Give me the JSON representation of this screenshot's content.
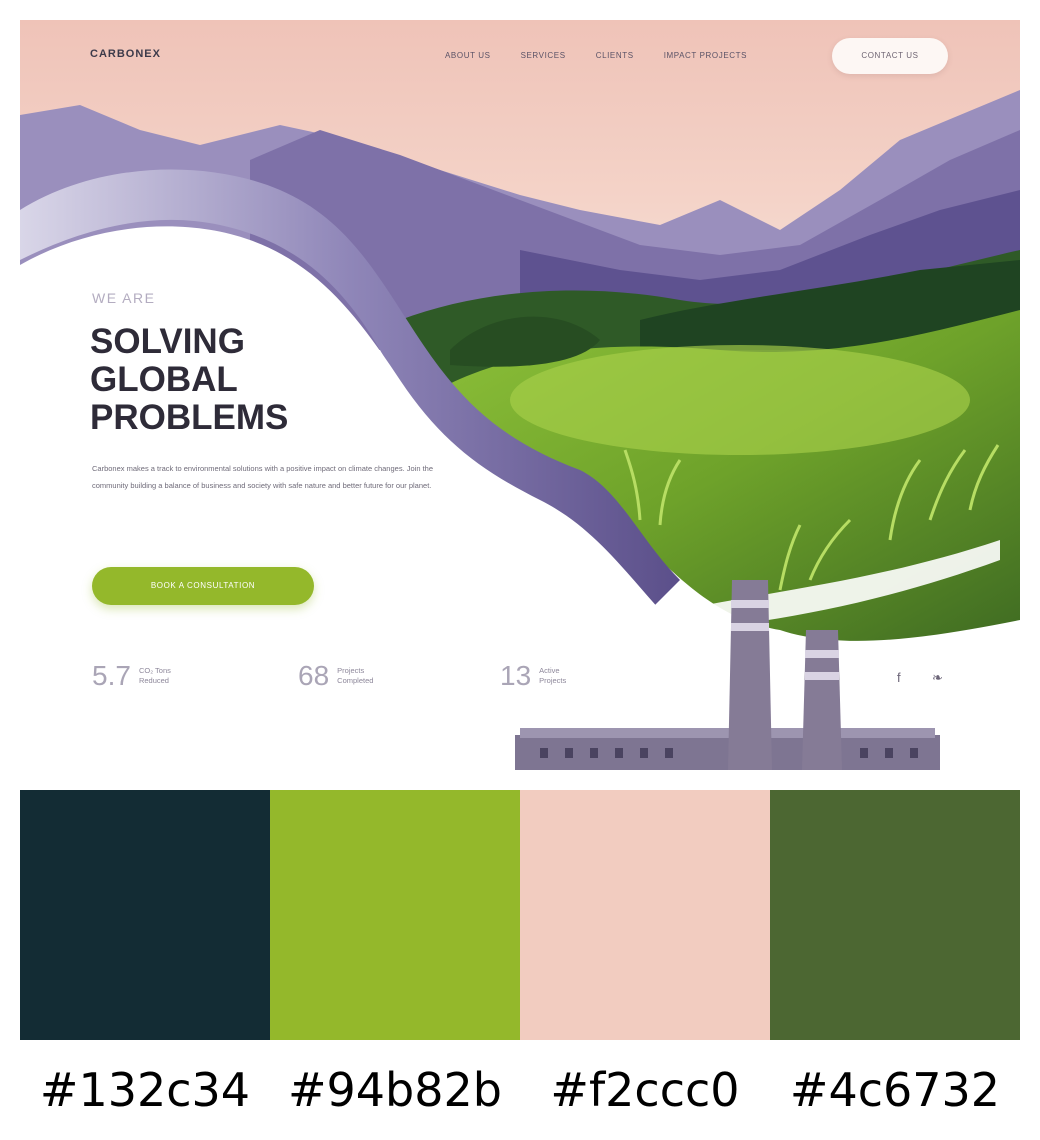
{
  "brand": {
    "logo": "CARBONEX"
  },
  "nav": {
    "links": [
      "ABOUT US",
      "SERVICES",
      "CLIENTS",
      "IMPACT PROJECTS"
    ],
    "contact_label": "CONTACT US"
  },
  "hero": {
    "eyebrow": "WE ARE",
    "headline": [
      "SOLVING",
      "GLOBAL",
      "PROBLEMS"
    ],
    "body": "Carbonex makes a track to environmental solutions with a positive impact on climate changes. Join the community building a balance of business and society with safe nature and better future for our planet.",
    "cta_label": "BOOK A CONSULTATION"
  },
  "stats": [
    {
      "value": "5.7",
      "label": [
        "CO₂ Tons",
        "Reduced"
      ]
    },
    {
      "value": "68",
      "label": [
        "Projects",
        "Completed"
      ]
    },
    {
      "value": "13",
      "label": [
        "Active",
        "Projects"
      ]
    }
  ],
  "social": {
    "facebook": "f",
    "twitter": "❧"
  },
  "palette": [
    {
      "hex": "#132c34",
      "label": "#132c34"
    },
    {
      "hex": "#94b82b",
      "label": "#94b82b"
    },
    {
      "hex": "#f2ccc0",
      "label": "#f2ccc0"
    },
    {
      "hex": "#4c6732",
      "label": "#4c6732"
    }
  ]
}
